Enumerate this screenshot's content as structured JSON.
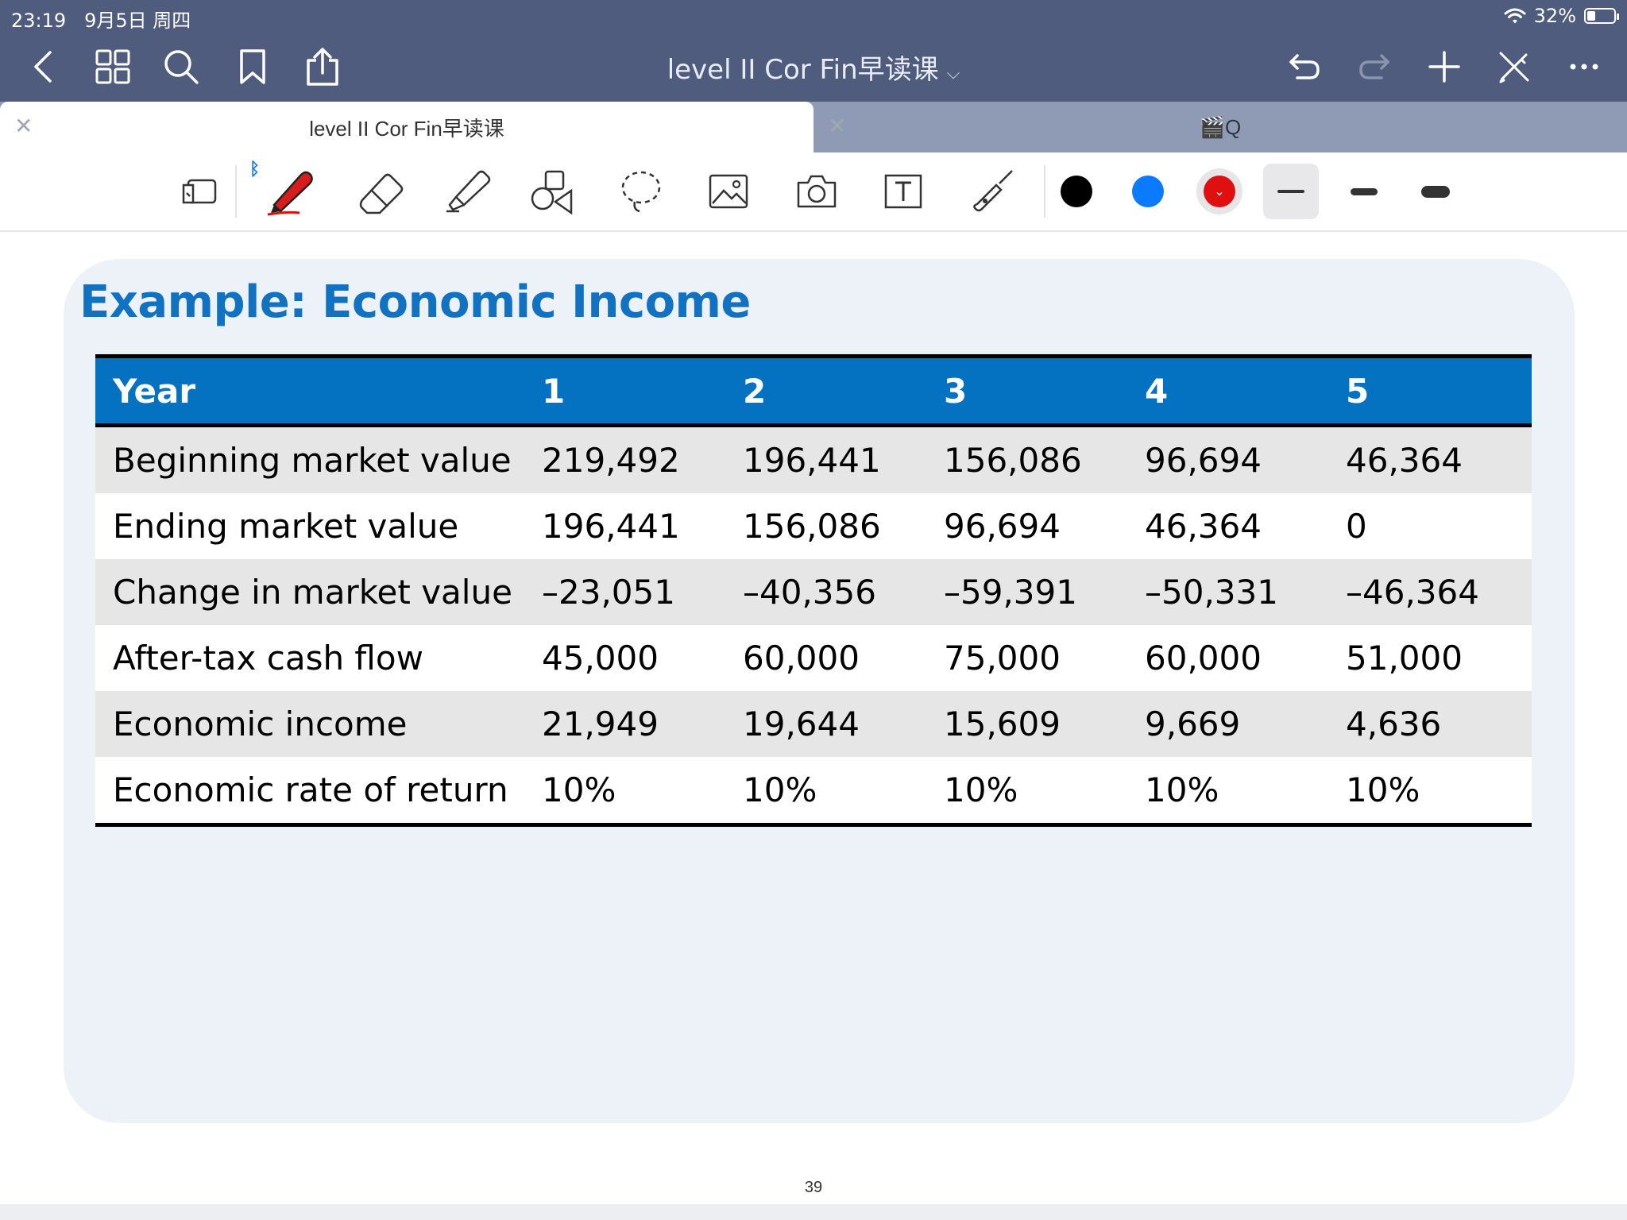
{
  "status_bar": {
    "time": "23:19",
    "date": "9月5日 周四",
    "battery": "32%",
    "battery_level": 0.32
  },
  "nav": {
    "title": "level II Cor Fin早读课"
  },
  "tabs": [
    {
      "label": "level II Cor Fin早读课"
    },
    {
      "label": "🎬Q"
    }
  ],
  "tools": {
    "colors": [
      "#000000",
      "#0a7aff",
      "#e01010"
    ],
    "icons": [
      "readonly-icon",
      "pen-icon",
      "eraser-icon",
      "highlighter-icon",
      "shapes-icon",
      "lasso-icon",
      "image-icon",
      "camera-icon",
      "text-icon",
      "laser-pointer-icon"
    ]
  },
  "slide": {
    "title": "Example: Economic Income",
    "table": {
      "headers": [
        "Year",
        "1",
        "2",
        "3",
        "4",
        "5"
      ],
      "rows": [
        [
          "Beginning market value",
          "219,492",
          "196,441",
          "156,086",
          "96,694",
          "46,364"
        ],
        [
          "Ending market value",
          "196,441",
          "156,086",
          "96,694",
          "46,364",
          "0"
        ],
        [
          "Change in market value",
          "–23,051",
          "–40,356",
          "–59,391",
          "–50,331",
          "–46,364"
        ],
        [
          "After-tax cash flow",
          "45,000",
          "60,000",
          "75,000",
          "60,000",
          "51,000"
        ],
        [
          "Economic income",
          "21,949",
          "19,644",
          "15,609",
          "9,669",
          "4,636"
        ],
        [
          "Economic rate of return",
          "10%",
          "10%",
          "10%",
          "10%",
          "10%"
        ]
      ]
    }
  },
  "page_number": "39"
}
